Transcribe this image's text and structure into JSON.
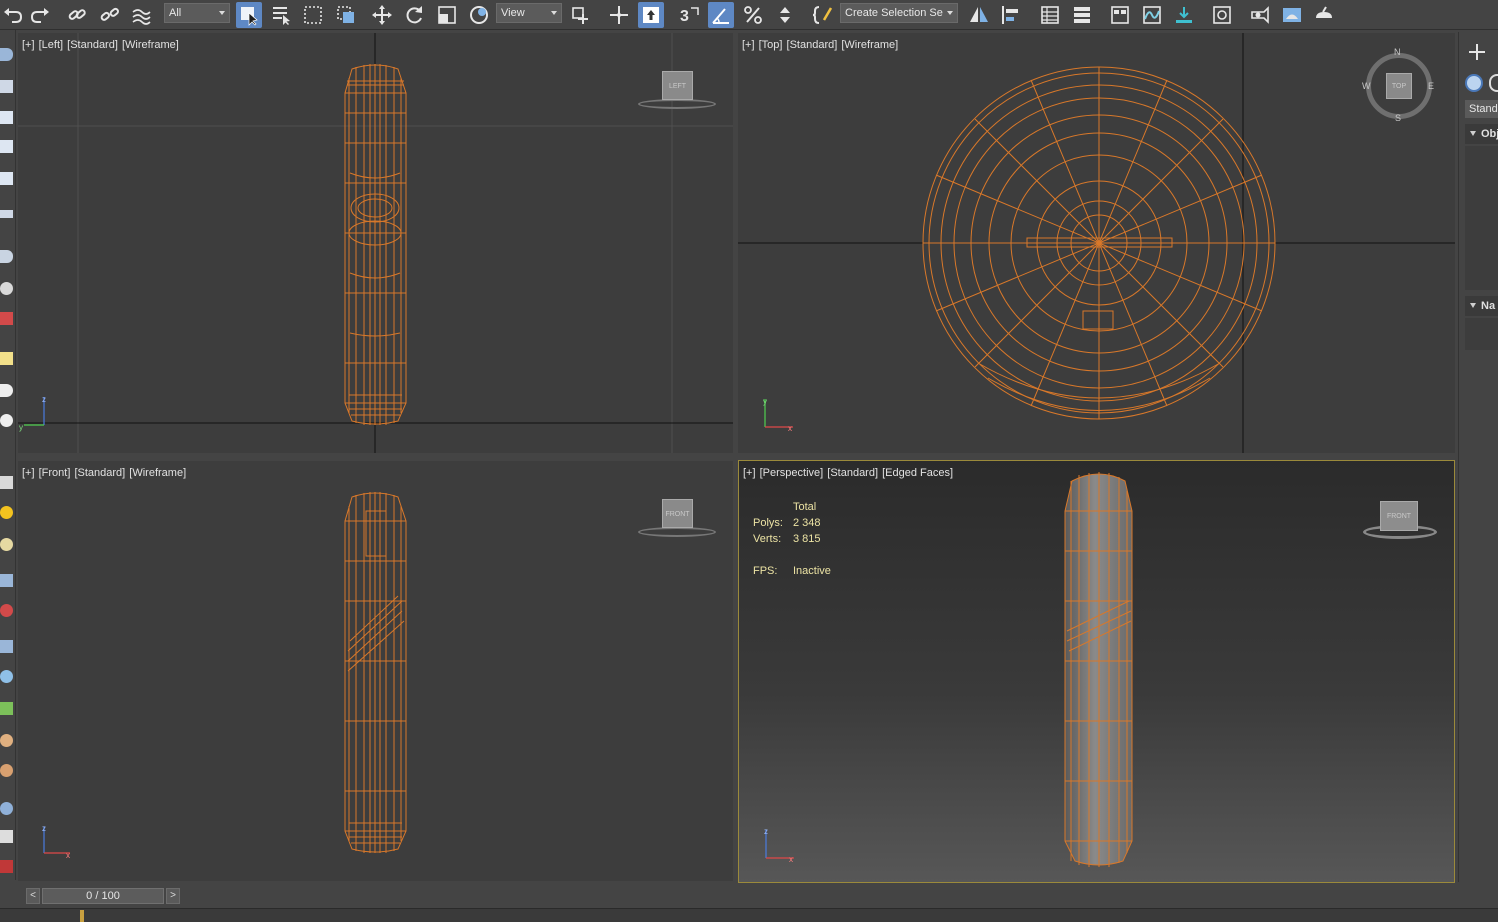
{
  "toolbar": {
    "filter_select": "All",
    "coord_select": "View",
    "selection_set": "Create Selection Se"
  },
  "viewports": {
    "left": {
      "plus": "[+]",
      "view": "[Left]",
      "shading": "[Standard]",
      "mode": "[Wireframe]",
      "cube": "LEFT"
    },
    "top": {
      "plus": "[+]",
      "view": "[Top]",
      "shading": "[Standard]",
      "mode": "[Wireframe]",
      "cube": "TOP",
      "compass": {
        "n": "N",
        "s": "S",
        "e": "E",
        "w": "W"
      }
    },
    "front": {
      "plus": "[+]",
      "view": "[Front]",
      "shading": "[Standard]",
      "mode": "[Wireframe]",
      "cube": "FRONT"
    },
    "perspective": {
      "plus": "[+]",
      "view": "[Perspective]",
      "shading": "[Standard]",
      "mode": "[Edged Faces]",
      "cube": "FRONT",
      "stats": {
        "header": "Total",
        "polys_label": "Polys:",
        "polys": "2 348",
        "verts_label": "Verts:",
        "verts": "3 815",
        "fps_label": "FPS:",
        "fps": "Inactive"
      }
    }
  },
  "axes": {
    "x": "x",
    "y": "y",
    "z": "z"
  },
  "command_panel": {
    "dropdown": "Standa",
    "rollout1": "Obj",
    "rollout2": "Na"
  },
  "timeline": {
    "prev": "<",
    "next": ">",
    "frame": "0 / 100"
  },
  "colors": {
    "wire": "#d8782a",
    "viewport_bg": "#3d3d3d",
    "active_border": "#9b8a3b",
    "stats_text": "#ece3a4"
  }
}
